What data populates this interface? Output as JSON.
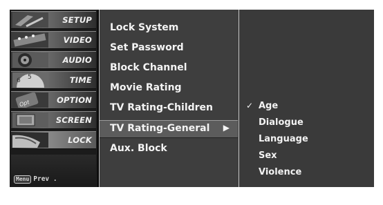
{
  "sidebar": {
    "items": [
      {
        "label": "SETUP",
        "icon": "setup-icon"
      },
      {
        "label": "VIDEO",
        "icon": "video-icon"
      },
      {
        "label": "AUDIO",
        "icon": "audio-icon"
      },
      {
        "label": "TIME",
        "icon": "time-icon"
      },
      {
        "label": "OPTION",
        "icon": "option-icon"
      },
      {
        "label": "SCREEN",
        "icon": "screen-icon"
      },
      {
        "label": "LOCK",
        "icon": "lock-icon",
        "active": true
      }
    ],
    "menu_key": "Menu",
    "prev_label": "Prev ."
  },
  "menu": {
    "items": [
      {
        "label": "Lock System"
      },
      {
        "label": "Set Password"
      },
      {
        "label": "Block Channel"
      },
      {
        "label": "Movie Rating"
      },
      {
        "label": "TV Rating-Children"
      },
      {
        "label": "TV Rating-General",
        "selected": true,
        "arrow": "▶"
      },
      {
        "label": "Aux. Block"
      }
    ]
  },
  "submenu": {
    "items": [
      {
        "label": "Age",
        "checked": true,
        "check": "✓"
      },
      {
        "label": "Dialogue"
      },
      {
        "label": "Language"
      },
      {
        "label": "Sex"
      },
      {
        "label": "Violence"
      }
    ]
  }
}
